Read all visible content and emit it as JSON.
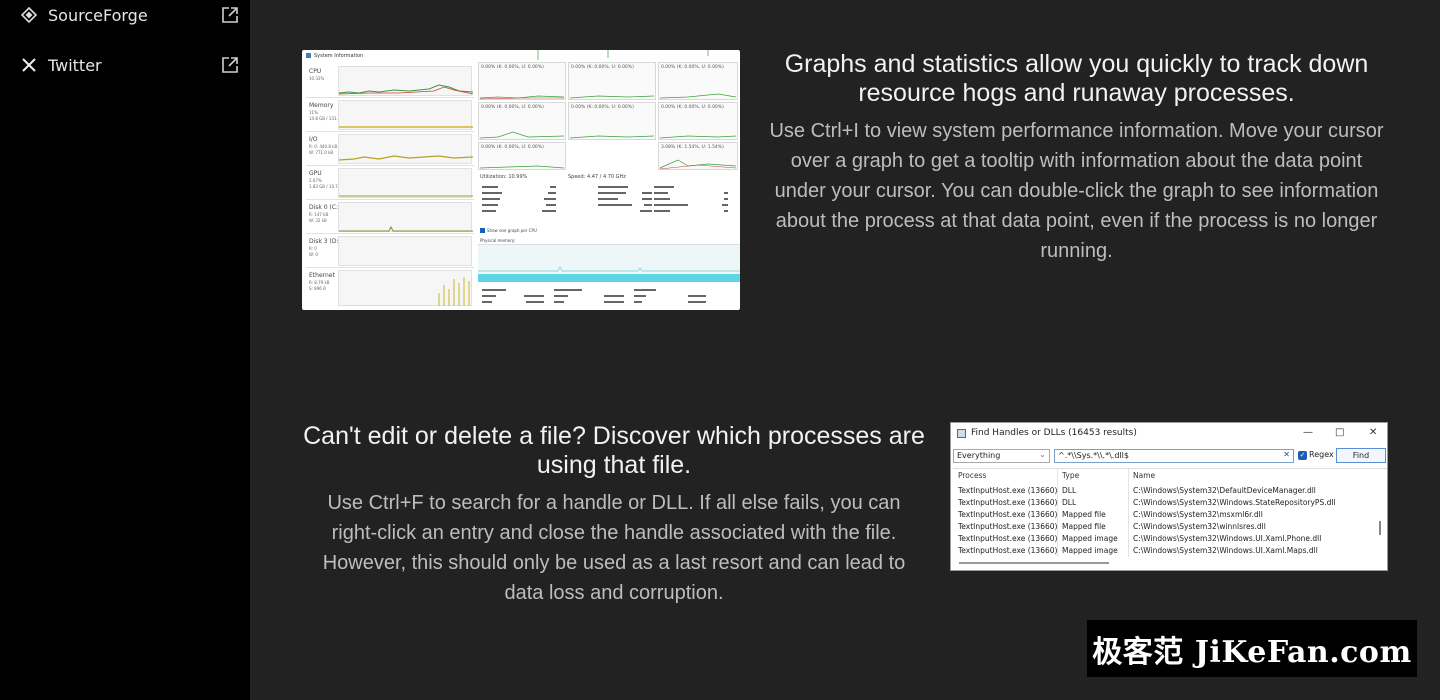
{
  "sidebar": {
    "links": [
      {
        "label": "SourceForge",
        "icon": "sourceforge-icon",
        "external": true
      },
      {
        "label": "Twitter",
        "icon": "x-twitter-icon",
        "external": true
      }
    ]
  },
  "features": [
    {
      "title": "Graphs and statistics allow you quickly to track down resource hogs and runaway processes.",
      "description": "Use Ctrl+I to view system performance information. Move your cursor over a graph to get a tooltip with information about the data point under your cursor. You can double-click the graph to see information about the process at that data point, even if the process is no longer running."
    },
    {
      "title": "Can't edit or delete a file? Discover which processes are using that file.",
      "description": "Use Ctrl+F to search for a handle or DLL. If all else fails, you can right-click an entry and close the handle associated with the file. However, this should only be used as a last resort and can lead to data loss and corruption."
    }
  ],
  "sysinfo": {
    "window_title": "System Information",
    "rows": [
      {
        "label": "CPU",
        "sub": "10.33%"
      },
      {
        "label": "Memory",
        "sub": "11%\n14.8 GB / 131.0 GB"
      },
      {
        "label": "I/O",
        "sub": "R: 0: 440.8 kB\nW: 771.0 kB"
      },
      {
        "label": "GPU",
        "sub": "2.67%\n1.83 GB / 10.79 GB"
      },
      {
        "label": "Disk 0 (C:)",
        "sub": "R: 147 kB\nW: 32 kB"
      },
      {
        "label": "Disk 3 (D:)",
        "sub": "R: 0\nW: 0"
      },
      {
        "label": "Ethernet",
        "sub": "R: 8.79 kB\nS: 896 B"
      }
    ],
    "cells": [
      "0.00% (K: 0.00%, U: 0.00%)",
      "0.00% (K: 0.00%, U: 0.00%)",
      "0.00% (K: 0.00%, U: 0.00%)",
      "0.00% (K: 0.00%, U: 0.00%)",
      "0.00% (K: 0.00%, U: 0.00%)",
      "0.00% (K: 0.00%, U: 0.00%)",
      "0.00% (K: 0.00%, U: 0.00%)",
      "3.08% (K: 1.54%, U: 1.54%)"
    ],
    "utilization_label": "Utilization:",
    "utilization": "10.99%",
    "speed_label": "Speed:",
    "speed": "4.47 / 4.70 GHz",
    "show_graph_label": "Show one graph per CPU",
    "physical_memory_label": "Physical memory:"
  },
  "find_handles": {
    "window_title": "Find Handles or DLLs (16453 results)",
    "filter_value": "Everything",
    "search_value": "^.*\\\\Sys.*\\\\.*\\.dll$",
    "regex_label": "Regex",
    "find_label": "Find",
    "columns": [
      "Process",
      "Type",
      "Name"
    ],
    "rows": [
      {
        "process": "TextInputHost.exe (13660)",
        "type": "DLL",
        "name": "C:\\Windows\\System32\\DefaultDeviceManager.dll"
      },
      {
        "process": "TextInputHost.exe (13660)",
        "type": "DLL",
        "name": "C:\\Windows\\System32\\Windows.StateRepositoryPS.dll"
      },
      {
        "process": "TextInputHost.exe (13660)",
        "type": "Mapped file",
        "name": "C:\\Windows\\System32\\msxml6r.dll"
      },
      {
        "process": "TextInputHost.exe (13660)",
        "type": "Mapped file",
        "name": "C:\\Windows\\System32\\winnlsres.dll"
      },
      {
        "process": "TextInputHost.exe (13660)",
        "type": "Mapped image",
        "name": "C:\\Windows\\System32\\Windows.UI.Xaml.Phone.dll"
      },
      {
        "process": "TextInputHost.exe (13660)",
        "type": "Mapped image",
        "name": "C:\\Windows\\System32\\Windows.UI.Xaml.Maps.dll"
      }
    ]
  },
  "watermark": "极客范 JiKeFan.com"
}
